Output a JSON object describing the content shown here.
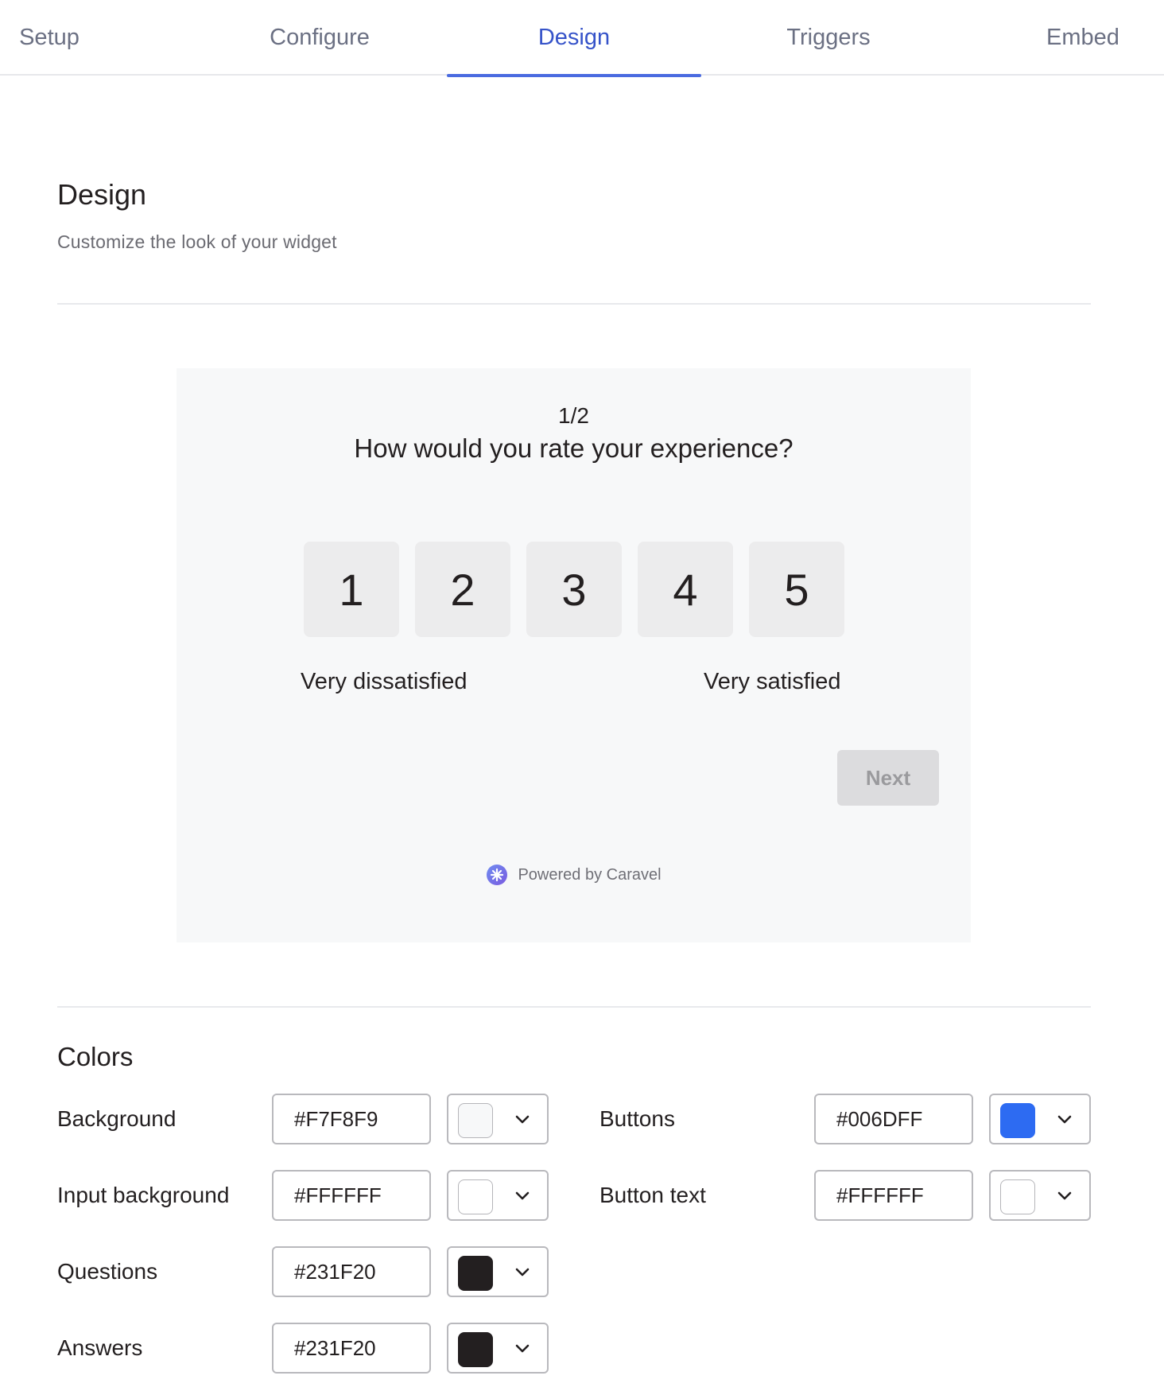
{
  "tabs": [
    {
      "label": "Setup",
      "active": false
    },
    {
      "label": "Configure",
      "active": false
    },
    {
      "label": "Design",
      "active": true
    },
    {
      "label": "Triggers",
      "active": false
    },
    {
      "label": "Embed",
      "active": false
    }
  ],
  "header": {
    "title": "Design",
    "subtitle": "Customize the look of your widget"
  },
  "preview": {
    "progress": "1/2",
    "question": "How would you rate your experience?",
    "ratings": [
      "1",
      "2",
      "3",
      "4",
      "5"
    ],
    "scale_low_label": "Very dissatisfied",
    "scale_high_label": "Very satisfied",
    "next_label": "Next",
    "powered_by": "Powered by Caravel"
  },
  "colors": {
    "title": "Colors",
    "left": [
      {
        "label": "Background",
        "value": "#F7F8F9",
        "swatch": "#F7F8F9"
      },
      {
        "label": "Input background",
        "value": "#FFFFFF",
        "swatch": "#FFFFFF"
      },
      {
        "label": "Questions",
        "value": "#231F20",
        "swatch": "#231F20"
      },
      {
        "label": "Answers",
        "value": "#231F20",
        "swatch": "#231F20"
      }
    ],
    "right": [
      {
        "label": "Buttons",
        "value": "#006DFF",
        "swatch": "#2D6BF2"
      },
      {
        "label": "Button text",
        "value": "#FFFFFF",
        "swatch": "#FFFFFF"
      }
    ]
  },
  "accent_color": "#4A6BE0"
}
